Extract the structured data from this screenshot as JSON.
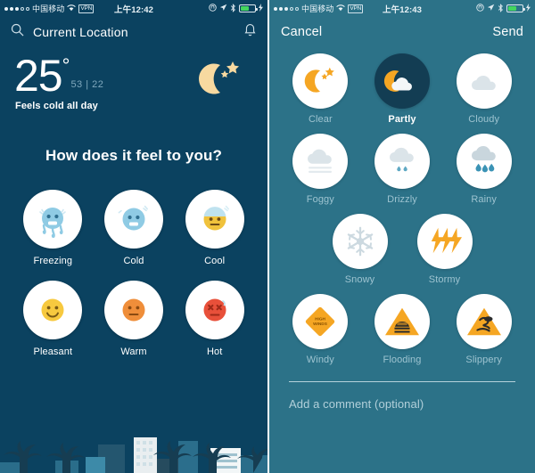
{
  "left": {
    "status_bar": {
      "signal_dots_filled": 3,
      "signal_dots_total": 5,
      "carrier": "中国移动",
      "wifi_icon": "wifi-icon",
      "vpn_label": "VPN",
      "time": "上午12:42",
      "rotation_lock_icon": "rotation-lock-icon",
      "location_icon": "location-arrow-icon",
      "bluetooth_icon": "bluetooth-icon",
      "battery_icon": "battery-icon",
      "charging_icon": "charging-bolt-icon"
    },
    "nav": {
      "search_icon": "search-icon",
      "location_title": "Current Location",
      "bell_icon": "bell-icon"
    },
    "weather": {
      "temperature": "25",
      "degree_symbol": "°",
      "high_low": "53 | 22",
      "feels_text": "Feels cold all day",
      "hero_icon": "moon-stars-icon"
    },
    "question": "How does it feel to you?",
    "moods": [
      {
        "label": "Freezing",
        "icon": "freezing-face-icon"
      },
      {
        "label": "Cold",
        "icon": "cold-face-icon"
      },
      {
        "label": "Cool",
        "icon": "cool-face-icon"
      },
      {
        "label": "Pleasant",
        "icon": "pleasant-face-icon"
      },
      {
        "label": "Warm",
        "icon": "warm-face-icon"
      },
      {
        "label": "Hot",
        "icon": "hot-face-icon"
      }
    ]
  },
  "right": {
    "status_bar": {
      "signal_dots_filled": 3,
      "signal_dots_total": 5,
      "carrier": "中国移动",
      "wifi_icon": "wifi-icon",
      "vpn_label": "VPN",
      "time": "上午12:43",
      "rotation_lock_icon": "rotation-lock-icon",
      "location_icon": "location-arrow-icon",
      "bluetooth_icon": "bluetooth-icon",
      "battery_icon": "battery-icon",
      "charging_icon": "charging-bolt-icon"
    },
    "nav": {
      "cancel_label": "Cancel",
      "send_label": "Send"
    },
    "conditions": [
      {
        "label": "Clear",
        "icon": "moon-stars-icon",
        "selected": false
      },
      {
        "label": "Partly",
        "icon": "moon-cloud-icon",
        "selected": true
      },
      {
        "label": "Cloudy",
        "icon": "cloud-icon",
        "selected": false
      },
      {
        "label": "Foggy",
        "icon": "fog-icon",
        "selected": false
      },
      {
        "label": "Drizzly",
        "icon": "drizzle-icon",
        "selected": false
      },
      {
        "label": "Rainy",
        "icon": "rain-icon",
        "selected": false
      },
      {
        "label": "Snowy",
        "icon": "snowflake-icon",
        "selected": false
      },
      {
        "label": "Stormy",
        "icon": "lightning-icon",
        "selected": false
      },
      {
        "label": "Windy",
        "icon": "high-winds-sign-icon",
        "selected": false
      },
      {
        "label": "Flooding",
        "icon": "flooding-sign-icon",
        "selected": false
      },
      {
        "label": "Slippery",
        "icon": "slippery-sign-icon",
        "selected": false
      }
    ],
    "comment": {
      "placeholder": "Add a comment (optional)",
      "value": ""
    }
  },
  "colors": {
    "left_bg": "#0b4260",
    "right_bg": "#2c7288",
    "selected_circle": "#133d53",
    "accent_yellow": "#f5a623",
    "moon": "#f7d9a0",
    "cold_face": "#8fcbe4",
    "pleasant_face": "#f7c93f",
    "warm_face": "#ef8e3a",
    "hot_face": "#e8503a",
    "muted_label": "#9dc3d0"
  }
}
